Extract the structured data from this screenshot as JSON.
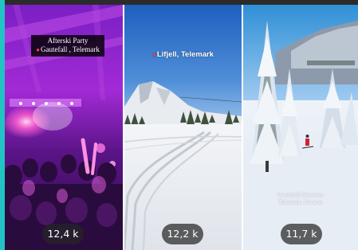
{
  "stories": [
    {
      "caption_line1": "Afterski Party",
      "caption_line2": "Gautefall , Telemark",
      "location_icon": "pin-icon",
      "views": "12,4 k",
      "scene": "purple-lit crowd at an indoor party"
    },
    {
      "caption": "Lifjell, Telemark",
      "location_icon": "pin-icon",
      "views": "12,2 k",
      "scene": "snowy slope with ski tracks under a blue sky"
    },
    {
      "caption_line1": "Gautefall Skisenter",
      "caption_line2": "Telemark, Norway",
      "views": "11,7 k",
      "scene": "snow-covered fir trees and a skier on a slope"
    }
  ],
  "colors": {
    "accent_strip": "#22c3c3",
    "pill_background": "#262626",
    "pin": "#ff3b3b"
  }
}
